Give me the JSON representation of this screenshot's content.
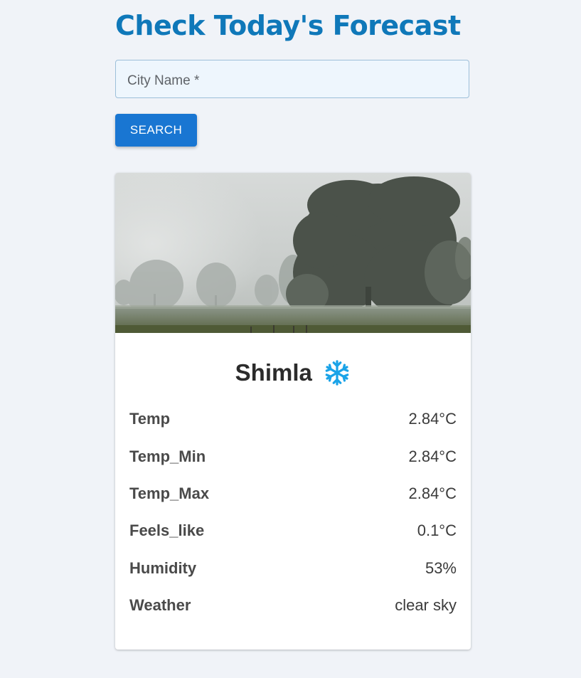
{
  "header": {
    "title": "Check Today's Forecast"
  },
  "search": {
    "placeholder": "City Name *",
    "value": "",
    "button_label": "SEARCH"
  },
  "result": {
    "city": "Shimla",
    "weather_icon": "snowflake-icon",
    "rows": [
      {
        "label": "Temp",
        "value": "2.84°C"
      },
      {
        "label": "Temp_Min",
        "value": "2.84°C"
      },
      {
        "label": "Temp_Max",
        "value": "2.84°C"
      },
      {
        "label": "Feels_like",
        "value": "0.1°C"
      },
      {
        "label": "Humidity",
        "value": "53%"
      },
      {
        "label": "Weather",
        "value": "clear sky"
      }
    ]
  },
  "colors": {
    "title": "#0f78b9",
    "button": "#1976d2",
    "background": "#f0f3f8",
    "icon": "#1aa3e8"
  }
}
